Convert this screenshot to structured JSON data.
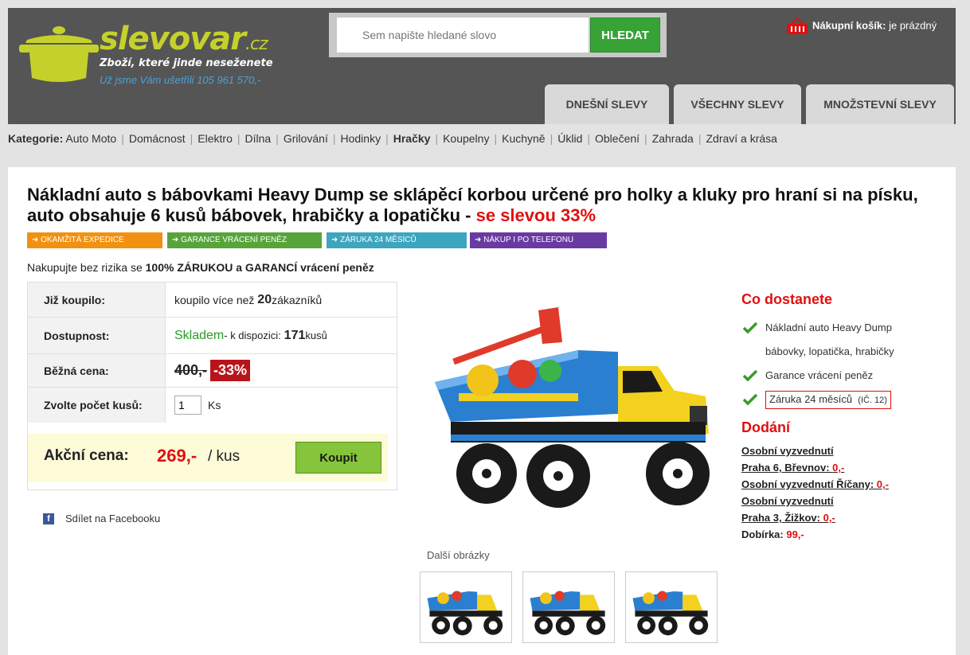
{
  "brand": {
    "name": "slevovar",
    "tld": ".cz",
    "tagline": "Zboží, které jinde neseženete",
    "savings": "Už jsme Vám ušetřili 105 961 570,-"
  },
  "search": {
    "placeholder": "Sem napište hledané slovo",
    "button": "HLEDAT"
  },
  "cart": {
    "label": "Nákupní košík:",
    "status": "je prázdný"
  },
  "tabs": [
    "DNEŠNÍ SLEVY",
    "VŠECHNY SLEVY",
    "MNOŽSTEVNÍ SLEVY"
  ],
  "categories": {
    "title": "Kategorie:",
    "items": [
      "Auto Moto",
      "Domácnost",
      "Elektro",
      "Dílna",
      "Grilování",
      "Hodinky",
      "Hračky",
      "Koupelny",
      "Kuchyně",
      "Úklid",
      "Oblečení",
      "Zahrada",
      "Zdraví a krása"
    ],
    "active": "Hračky"
  },
  "product": {
    "title": "Nákladní auto s bábovkami Heavy Dump se sklápěcí korbou určené pro holky a kluky pro hraní si na písku, auto obsahuje 6 kusů bábovek, hrabičky a lopatičku - ",
    "discount_text": "se slevou 33%",
    "badges": [
      {
        "text": "➜ OKAMŽITÁ EXPEDICE",
        "color": "#f29111"
      },
      {
        "text": "➜ GARANCE VRÁCENÍ PENĚZ",
        "color": "#57a43a"
      },
      {
        "text": "➜ ZÁRUKA 24 MĚSÍCŮ",
        "color": "#3ca5c0"
      },
      {
        "text": "➜ NÁKUP I PO TELEFONU",
        "color": "#6a3aa3"
      }
    ],
    "guarantee": {
      "prefix": "Nakupujte bez rizika se ",
      "bold": "100% ZÁRUKOU a GARANCÍ",
      "suffix": " vrácení peněz"
    }
  },
  "info": {
    "bought_label": "Již koupilo:",
    "bought_prefix": "koupilo více než ",
    "bought_count": "20",
    "bought_suffix": " zákazníků",
    "availability_label": "Dostupnost:",
    "availability_status": "Skladem",
    "availability_prefix": " - k dispozici: ",
    "availability_count": "171",
    "availability_suffix": " kusů",
    "regular_label": "Běžná cena:",
    "regular_price": "400,-",
    "discount_pct": "-33%",
    "qty_label": "Zvolte počet kusů:",
    "qty_value": "1",
    "qty_unit": "Ks",
    "action_label": "Akční cena:",
    "action_price": "269,-",
    "action_unit": "/ kus",
    "buy_button": "Koupit"
  },
  "facebook": {
    "icon": "f",
    "label": "Sdílet na Facebooku"
  },
  "gallery": {
    "more_label": "Další obrázky",
    "thumb_count": 3
  },
  "sidebar": {
    "what_heading": "Co dostanete",
    "items": [
      {
        "line1": "Nákladní auto Heavy Dump",
        "line2": "bábovky, lopatička, hrabičky"
      },
      {
        "line1": "Garance vrácení peněz"
      },
      {
        "line1": "Záruka 24 měsíců",
        "note": "(IČ. 12)"
      }
    ],
    "delivery_heading": "Dodání",
    "delivery": [
      {
        "text": "Osobní vyzvednutí",
        "link": true
      },
      {
        "text": "Praha 6, Břevnov: ",
        "price": "0,-",
        "link": true
      },
      {
        "text": "Osobní vyzvednutí Říčany: ",
        "price": "0,-",
        "link": true
      },
      {
        "text": "Osobní vyzvednutí",
        "link": true
      },
      {
        "text": "Praha 3, Žižkov: ",
        "price": "0,-",
        "link": true
      },
      {
        "text": "Dobírka: ",
        "price": "99,-",
        "link": false
      }
    ]
  },
  "colors": {
    "header_bg": "#555555",
    "brand": "#c5d12b",
    "accent_red": "#e01010",
    "green": "#37a337"
  }
}
